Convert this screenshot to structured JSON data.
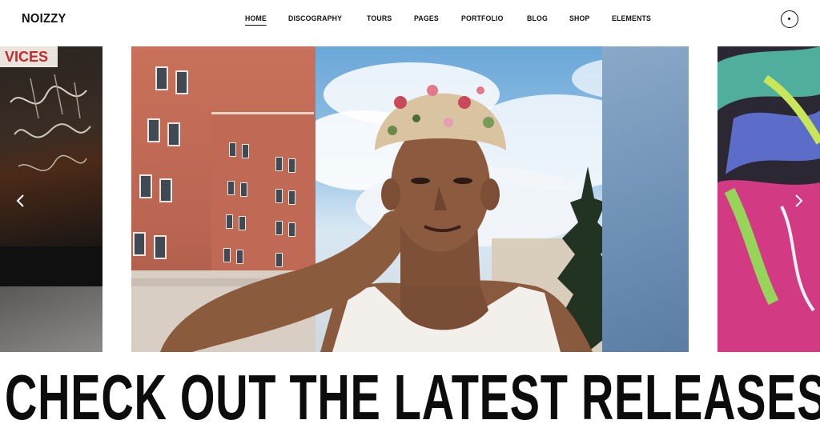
{
  "header": {
    "logo": "NOIZZY",
    "nav": [
      {
        "label": "HOME",
        "active": true
      },
      {
        "label": "DISCOGRAPHY",
        "active": false
      },
      {
        "label": "TOURS",
        "active": false
      },
      {
        "label": "PAGES",
        "active": false
      },
      {
        "label": "PORTFOLIO",
        "active": false
      },
      {
        "label": "BLOG",
        "active": false
      },
      {
        "label": "SHOP",
        "active": false
      },
      {
        "label": "ELEMENTS",
        "active": false
      }
    ],
    "menu_icon": "circle-dot-icon"
  },
  "slider": {
    "left_slide_sign": "VICES",
    "prev_icon": "chevron-left-icon",
    "next_icon": "chevron-right-icon"
  },
  "headline": "CHECK OUT THE LATEST RELEASES F",
  "colors": {
    "text": "#0c0c0c",
    "background": "#ffffff",
    "sky": "#6aa7d8",
    "brick": "#c06a55"
  }
}
